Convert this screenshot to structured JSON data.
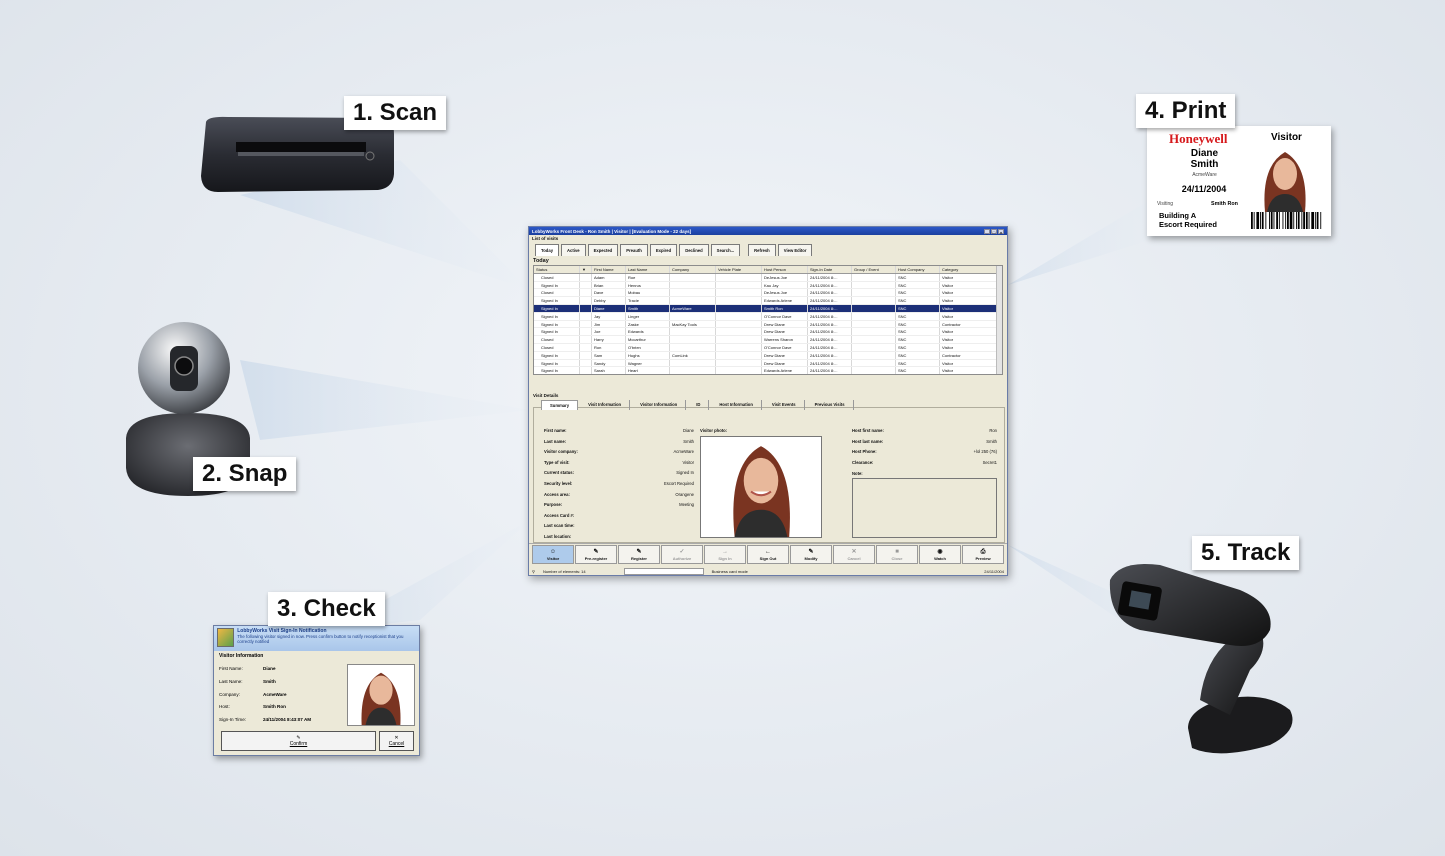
{
  "steps": {
    "scan": "1. Scan",
    "snap": "2. Snap",
    "check": "3. Check",
    "print": "4. Print",
    "track": "5. Track"
  },
  "colors": {
    "background": "#e6ebf1",
    "window_title": "#1b3f9f",
    "selected_row": "#1c2f78",
    "badge_brand": "#d6191c"
  },
  "app": {
    "title": "LobbyWorks Front Desk - Ron Smith | Visitor | [Evaluation Mode - 22 days]",
    "list_caption": "List of visits",
    "tabs": [
      "Today",
      "Active",
      "Expected",
      "Preauth",
      "Expired",
      "Declined",
      "Search...",
      "Refresh",
      "View Editor"
    ],
    "today_caption": "Today",
    "columns": [
      "Status",
      "▼",
      "First Name",
      "Last Name",
      "Company",
      "Vehicle Plate",
      "Host Person",
      "Sign-In Date",
      "Group / Event",
      "Host Company",
      "Category"
    ],
    "rows": [
      {
        "status": "Closed",
        "first": "Adam",
        "last": "Roe",
        "company": "",
        "host": "DeJesus Joe",
        "date": "24/11/2004 8:...",
        "hostco": "SNC",
        "category": "Visitor"
      },
      {
        "status": "Signed In",
        "first": "Brian",
        "last": "Henrus",
        "company": "",
        "host": "Kau Jay",
        "date": "24/11/2004 8:...",
        "hostco": "SNC",
        "category": "Visitor"
      },
      {
        "status": "Closed",
        "first": "Dave",
        "last": "Mobau",
        "company": "",
        "host": "DeJesus Joe",
        "date": "24/11/2004 8:...",
        "hostco": "SNC",
        "category": "Visitor"
      },
      {
        "status": "Signed In",
        "first": "Debby",
        "last": "Tracie",
        "company": "",
        "host": "Edwards Arlene",
        "date": "24/11/2004 8:...",
        "hostco": "SNC",
        "category": "Visitor"
      },
      {
        "status": "Signed In",
        "first": "Diane",
        "last": "Smith",
        "company": "AcmeWare",
        "host": "Smith Ron",
        "date": "24/11/2004 8:...",
        "hostco": "SNC",
        "category": "Visitor"
      },
      {
        "status": "Signed In",
        "first": "Jay",
        "last": "Linger",
        "company": "",
        "host": "O'Connor Dave",
        "date": "24/11/2004 8:...",
        "hostco": "SNC",
        "category": "Visitor"
      },
      {
        "status": "Signed In",
        "first": "Jim",
        "last": "Zaske",
        "company": "MacKay Tools",
        "host": "Drew Diane",
        "date": "24/11/2004 8:...",
        "hostco": "SNC",
        "category": "Contractor"
      },
      {
        "status": "Signed In",
        "first": "Joe",
        "last": "Edwards",
        "company": "",
        "host": "Drew Diane",
        "date": "24/11/2004 8:...",
        "hostco": "SNC",
        "category": "Visitor"
      },
      {
        "status": "Closed",
        "first": "Harry",
        "last": "Mccarthur",
        "company": "",
        "host": "Warrens Sharon",
        "date": "24/11/2004 8:...",
        "hostco": "SNC",
        "category": "Visitor"
      },
      {
        "status": "Closed",
        "first": "Ron",
        "last": "O'brien",
        "company": "",
        "host": "O'Connor Dave",
        "date": "24/11/2004 8:...",
        "hostco": "SNC",
        "category": "Visitor"
      },
      {
        "status": "Signed In",
        "first": "Sam",
        "last": "Hughs",
        "company": "ComLink",
        "host": "Drew Diane",
        "date": "24/11/2004 8:...",
        "hostco": "SNC",
        "category": "Contractor"
      },
      {
        "status": "Signed In",
        "first": "Sandy",
        "last": "Wagner",
        "company": "",
        "host": "Drew Diane",
        "date": "24/11/2004 8:...",
        "hostco": "SNC",
        "category": "Visitor"
      },
      {
        "status": "Signed In",
        "first": "Sarah",
        "last": "Heart",
        "company": "",
        "host": "Edwards Arlene",
        "date": "24/11/2004 8:...",
        "hostco": "SNC",
        "category": "Visitor"
      }
    ],
    "details_caption": "Visit Details",
    "detail_tabs": [
      "Summary",
      "Visit Information",
      "Visitor Information",
      "ID",
      "Host Information",
      "Visit Events",
      "Previous Visits"
    ],
    "visitor_fields": [
      {
        "label": "First name:",
        "value": "Diane"
      },
      {
        "label": "Last name:",
        "value": "Smith"
      },
      {
        "label": "Visitor company:",
        "value": "AcmeWare"
      },
      {
        "label": "Type of visit:",
        "value": "Visitor"
      },
      {
        "label": "Current status:",
        "value": "Signed In"
      },
      {
        "label": "Security level:",
        "value": "Escort Required"
      },
      {
        "label": "Access area:",
        "value": "Orangene"
      },
      {
        "label": "Purpose:",
        "value": "Meeting"
      },
      {
        "label": "Access Card #:",
        "value": ""
      },
      {
        "label": "Last scan time:",
        "value": ""
      },
      {
        "label": "Last location:",
        "value": ""
      }
    ],
    "photo_label": "Visitor photo:",
    "host_fields": [
      {
        "label": "Host first name:",
        "value": "Ron"
      },
      {
        "label": "Host last name:",
        "value": "Smith"
      },
      {
        "label": "Host Phone:",
        "value": "+lol 250 (76)"
      },
      {
        "label": "Clearance:",
        "value": "Secret1"
      }
    ],
    "note_label": "Note:",
    "toolbar": [
      {
        "label": "Visitor",
        "state": "primary"
      },
      {
        "label": "Pre-register",
        "state": "normal"
      },
      {
        "label": "Register",
        "state": "normal"
      },
      {
        "label": "Authorize",
        "state": "disabled"
      },
      {
        "label": "Sign In",
        "state": "disabled"
      },
      {
        "label": "Sign Out",
        "state": "normal"
      },
      {
        "label": "Modify",
        "state": "normal"
      },
      {
        "label": "Cancel",
        "state": "disabled"
      },
      {
        "label": "Close",
        "state": "disabled"
      },
      {
        "label": "Watch",
        "state": "normal"
      },
      {
        "label": "Preview",
        "state": "normal"
      }
    ],
    "status_count": "Number of elements: 14",
    "status_card_mode": "Business card mode",
    "status_date": "24/11/2004"
  },
  "notify": {
    "title": "LobbyWorks Visit Sign-In Notification",
    "message": "The following visitor signed in now. Press confirm button to notify receptionist that you correctly notified",
    "section": "Visitor Information",
    "fields": [
      {
        "label": "First Name:",
        "value": "Diane"
      },
      {
        "label": "Last Name:",
        "value": "Smith"
      },
      {
        "label": "Company:",
        "value": "AcmeWare"
      },
      {
        "label": "Host:",
        "value": "Smith Ron"
      },
      {
        "label": "Sign-In Time:",
        "value": "24/11/2004 8:43:07 AM"
      }
    ],
    "confirm": "Confirm",
    "cancel": "Cancel"
  },
  "badge": {
    "brand": "Honeywell",
    "type": "Visitor",
    "first_name": "Diane",
    "last_name": "Smith",
    "company": "AcmeWare",
    "date": "24/11/2004",
    "visiting_label": "Visiting",
    "host": "Smith Ron",
    "building": "Building A",
    "escort": "Escort Required"
  }
}
